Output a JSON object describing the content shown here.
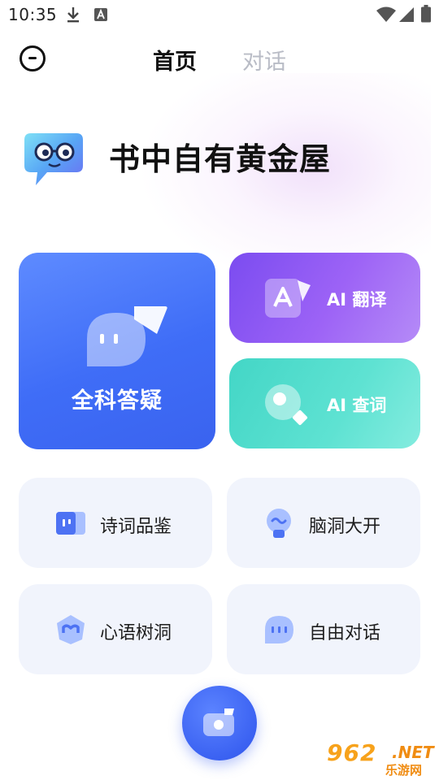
{
  "status_bar": {
    "time": "10:35",
    "icons": [
      "download-icon",
      "font-a-icon",
      "wifi-icon",
      "cell-signal-icon",
      "battery-icon"
    ]
  },
  "nav": {
    "menu_icon": "minus-circle-icon",
    "tabs": [
      {
        "label": "首页",
        "active": true
      },
      {
        "label": "对话",
        "active": false
      }
    ]
  },
  "hero": {
    "mascot": "chat-bubble-mascot-with-glasses",
    "title": "书中自有黄金屋"
  },
  "features": {
    "main": {
      "label": "全科答疑",
      "icon": "chat-bubble-icon",
      "color": "#3f6df7"
    },
    "translate": {
      "label": "AI 翻译",
      "icon": "translate-a-icon",
      "color": "#8b57f3"
    },
    "lookup": {
      "label": "AI 查词",
      "icon": "magnifier-icon",
      "color": "#4fdccb"
    }
  },
  "tiles": [
    {
      "label": "诗词品鉴",
      "icon": "quote-card-icon"
    },
    {
      "label": "脑洞大开",
      "icon": "lightbulb-icon"
    },
    {
      "label": "心语树洞",
      "icon": "heart-m-icon"
    },
    {
      "label": "自由对话",
      "icon": "chat-dots-icon"
    }
  ],
  "camera": {
    "icon": "camera-icon"
  },
  "watermark": {
    "number": "962",
    "suffix": ".NET",
    "text": "乐游网"
  },
  "colors": {
    "accent": "#3f6df7",
    "tile_bg": "#f1f4fc",
    "tab_inactive": "#b9bcc6"
  }
}
